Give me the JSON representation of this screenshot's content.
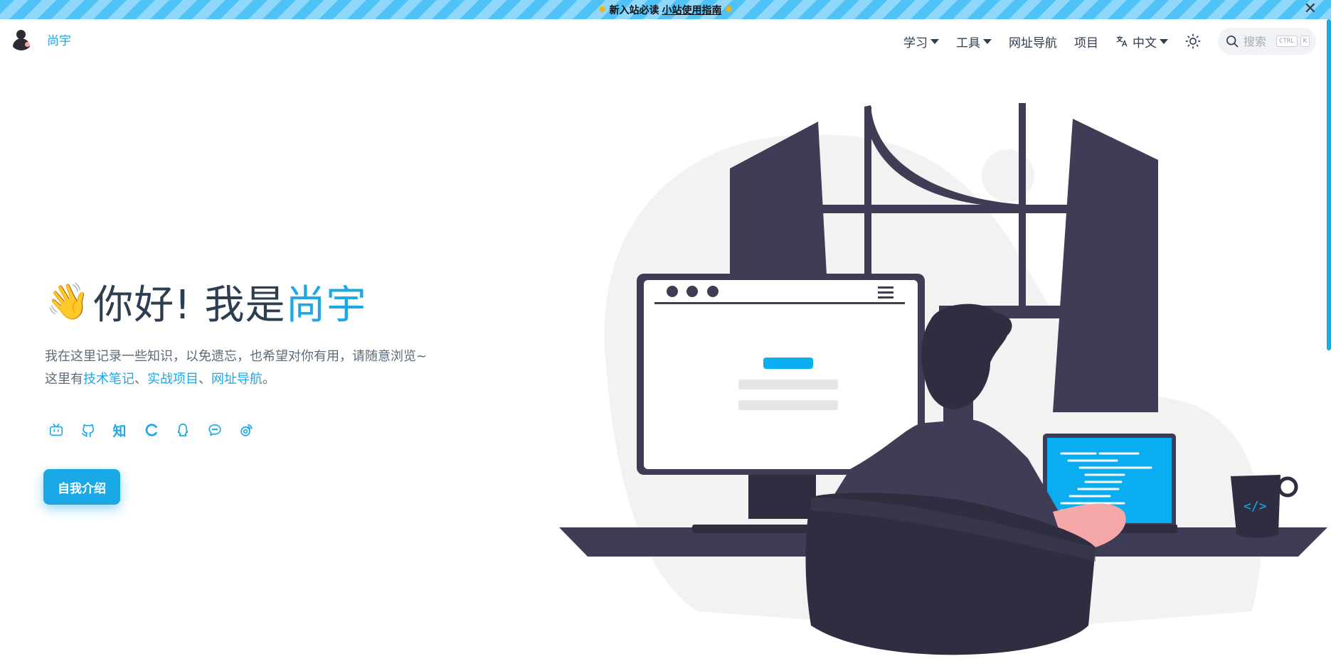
{
  "announcement": {
    "prefix": "新入站必读",
    "link": "小站使用指南",
    "spark": "✸",
    "close": "✕"
  },
  "brand": {
    "name": "尚宇"
  },
  "nav": {
    "items": [
      {
        "label": "学习",
        "dropdown": true
      },
      {
        "label": "工具",
        "dropdown": true
      },
      {
        "label": "网址导航",
        "dropdown": false
      },
      {
        "label": "项目",
        "dropdown": false
      }
    ],
    "language": "中文",
    "language_icon": "文A",
    "search_placeholder": "搜索",
    "search_shortcut": [
      "CTRL",
      "K"
    ]
  },
  "hero": {
    "wave": "👋",
    "title_prefix": "你好! 我是",
    "title_highlight": "尚宇",
    "desc_line1": "我在这里记录一些知识，以免遗忘，也希望对你有用，请随意浏览~",
    "desc_line2_prefix": "这里有",
    "links": [
      "技术笔记",
      "实战项目",
      "网址导航"
    ],
    "sep": "、",
    "end": "。",
    "button": "自我介绍"
  },
  "socials": [
    {
      "name": "bilibili-icon",
      "glyph": ""
    },
    {
      "name": "github-icon",
      "glyph": ""
    },
    {
      "name": "zhihu-icon",
      "glyph": "知"
    },
    {
      "name": "csdn-icon",
      "glyph": "C"
    },
    {
      "name": "qq-icon",
      "glyph": ""
    },
    {
      "name": "wechat-icon",
      "glyph": ""
    },
    {
      "name": "weibo-icon",
      "glyph": ""
    }
  ],
  "illustration": {
    "screen_label": "</>"
  },
  "colors": {
    "accent": "#1aa9e6",
    "text": "#2c3e50",
    "dark": "#3f3d56"
  }
}
